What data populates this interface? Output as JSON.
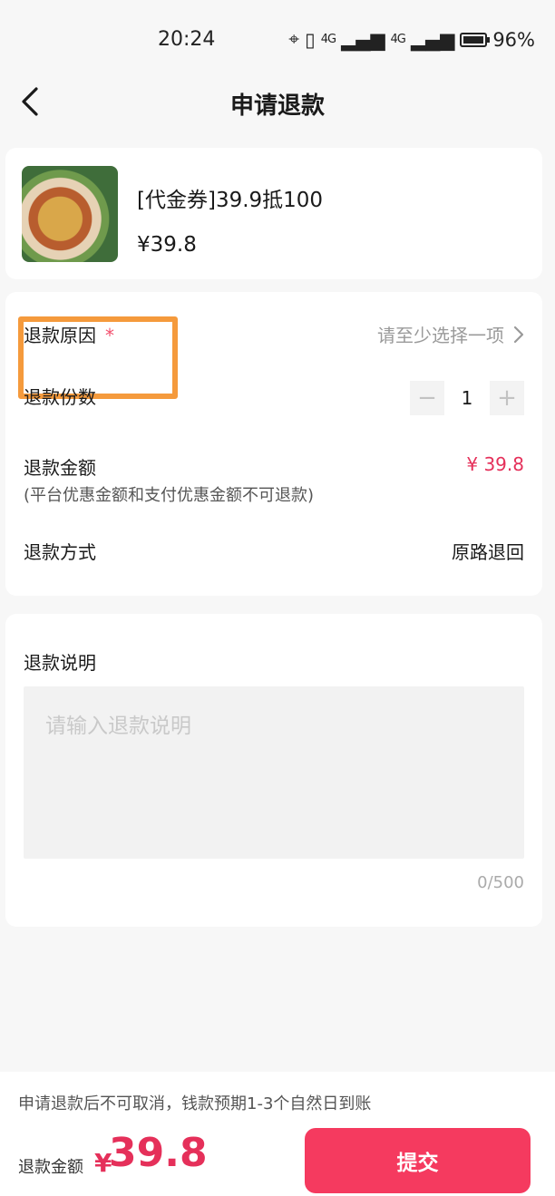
{
  "status_bar": {
    "time": "20:24",
    "network1": "4G",
    "network2": "4G",
    "battery": "96%"
  },
  "nav": {
    "title": "申请退款"
  },
  "product": {
    "name": "[代金券]39.9抵100",
    "price": "¥39.8"
  },
  "form": {
    "reason_label": "退款原因",
    "required_mark": "*",
    "reason_placeholder": "请至少选择一项",
    "quantity_label": "退款份数",
    "quantity": "1",
    "minus": "−",
    "plus": "+",
    "amount_label": "退款金额",
    "amount_note": "(平台优惠金额和支付优惠金额不可退款)",
    "amount_value": "¥ 39.8",
    "method_label": "退款方式",
    "method_value": "原路退回"
  },
  "description": {
    "title": "退款说明",
    "placeholder": "请输入退款说明",
    "count": "0/500"
  },
  "footer": {
    "notice": "申请退款后不可取消，钱款预期1-3个自然日到账",
    "total_label": "退款金额",
    "currency": "¥",
    "total_amount": "39.8",
    "submit_label": "提交"
  },
  "colors": {
    "accent": "#f53a5f",
    "price": "#e5305a",
    "highlight": "#f59a3c"
  }
}
